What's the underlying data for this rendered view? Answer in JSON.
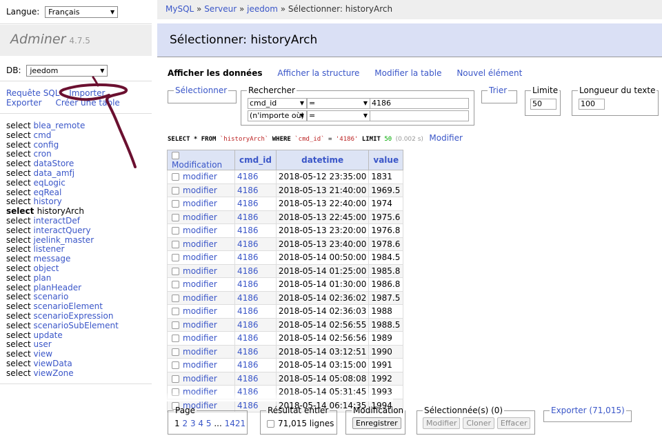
{
  "menu": {
    "lang_label": "Langue:",
    "lang_value": "Français",
    "brand_name": "Adminer",
    "brand_version": "4.7.5",
    "db_label": "DB:",
    "db_value": "jeedom",
    "links": [
      "Requête SQL",
      "Importer",
      "Exporter",
      "Créer une table"
    ],
    "select_word": "select",
    "tables": [
      "blea_remote",
      "cmd",
      "config",
      "cron",
      "dataStore",
      "data_amfj",
      "eqLogic",
      "eqReal",
      "history",
      "historyArch",
      "interactDef",
      "interactQuery",
      "jeelink_master",
      "listener",
      "message",
      "object",
      "plan",
      "planHeader",
      "scenario",
      "scenarioElement",
      "scenarioExpression",
      "scenarioSubElement",
      "update",
      "user",
      "view",
      "viewData",
      "viewZone"
    ],
    "current_table": "historyArch"
  },
  "breadcrumb": {
    "items": [
      "MySQL",
      "Serveur",
      "jeedom"
    ],
    "sep": " » ",
    "current": "Sélectionner: historyArch"
  },
  "page_title": "Sélectionner: historyArch",
  "tabs": [
    "Afficher les données",
    "Afficher la structure",
    "Modifier la table",
    "Nouvel élément"
  ],
  "form": {
    "select_legend": "Sélectionner",
    "search_legend": "Rechercher",
    "search_rows": [
      {
        "column": "cmd_id",
        "op": "=",
        "value": "4186"
      },
      {
        "column": "(n'importe où)",
        "op": "=",
        "value": ""
      }
    ],
    "sort_legend": "Trier",
    "limit_legend": "Limite",
    "limit_value": "50",
    "textlen_legend": "Longueur du texte",
    "textlen_value": "100"
  },
  "query": {
    "kw1": "SELECT * FROM",
    "table": "`historyArch`",
    "kw2": "WHERE",
    "col": "`cmd_id`",
    "eq": "=",
    "val": "'4186'",
    "kw3": "LIMIT",
    "limit": "50",
    "time": "(0.002 s)",
    "edit_link": "Modifier"
  },
  "table": {
    "headers": [
      "Modification",
      "cmd_id",
      "datetime",
      "value"
    ],
    "edit_label": "modifier",
    "rows": [
      {
        "cmd_id": "4186",
        "datetime": "2018-05-12 23:35:00",
        "value": "1831"
      },
      {
        "cmd_id": "4186",
        "datetime": "2018-05-13 21:40:00",
        "value": "1969.5"
      },
      {
        "cmd_id": "4186",
        "datetime": "2018-05-13 22:40:00",
        "value": "1974"
      },
      {
        "cmd_id": "4186",
        "datetime": "2018-05-13 22:45:00",
        "value": "1975.6"
      },
      {
        "cmd_id": "4186",
        "datetime": "2018-05-13 23:20:00",
        "value": "1976.8"
      },
      {
        "cmd_id": "4186",
        "datetime": "2018-05-13 23:40:00",
        "value": "1978.6"
      },
      {
        "cmd_id": "4186",
        "datetime": "2018-05-14 00:50:00",
        "value": "1984.5"
      },
      {
        "cmd_id": "4186",
        "datetime": "2018-05-14 01:25:00",
        "value": "1985.8"
      },
      {
        "cmd_id": "4186",
        "datetime": "2018-05-14 01:30:00",
        "value": "1986.8"
      },
      {
        "cmd_id": "4186",
        "datetime": "2018-05-14 02:36:02",
        "value": "1987.5"
      },
      {
        "cmd_id": "4186",
        "datetime": "2018-05-14 02:36:03",
        "value": "1988"
      },
      {
        "cmd_id": "4186",
        "datetime": "2018-05-14 02:56:55",
        "value": "1988.5"
      },
      {
        "cmd_id": "4186",
        "datetime": "2018-05-14 02:56:56",
        "value": "1989"
      },
      {
        "cmd_id": "4186",
        "datetime": "2018-05-14 03:12:51",
        "value": "1990"
      },
      {
        "cmd_id": "4186",
        "datetime": "2018-05-14 03:15:00",
        "value": "1991"
      },
      {
        "cmd_id": "4186",
        "datetime": "2018-05-14 05:08:08",
        "value": "1992"
      },
      {
        "cmd_id": "4186",
        "datetime": "2018-05-14 05:31:45",
        "value": "1993"
      },
      {
        "cmd_id": "4186",
        "datetime": "2018-05-14 06:14:35",
        "value": "1994"
      }
    ]
  },
  "footer": {
    "page_legend": "Page",
    "pages": [
      "1",
      "2",
      "3",
      "4",
      "5",
      "...",
      "1421"
    ],
    "result_legend": "Résultat entier",
    "result_count": "71,015 lignes",
    "modif_legend": "Modification",
    "save_label": "Enregistrer",
    "selected_legend": "Sélectionnée(s) (0)",
    "btn_edit": "Modifier",
    "btn_clone": "Cloner",
    "btn_delete": "Effacer",
    "export_legend": "Exporter (71,015)"
  }
}
